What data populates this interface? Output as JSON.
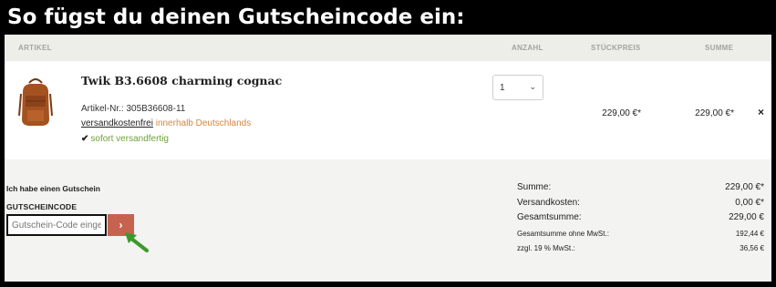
{
  "headline": "So fügst du deinen Gutscheincode ein:",
  "table": {
    "headers": {
      "artikel": "Artikel",
      "anzahl": "Anzahl",
      "stueckpreis": "Stückpreis",
      "summe": "Summe"
    }
  },
  "product": {
    "name": "Twik B3.6608 charming cognac",
    "article_number": "Artikel-Nr.: 305B36608-11",
    "shipping_link": "versandkostenfrei",
    "shipping_region": " innerhalb Deutschlands",
    "stock_icon": "check-icon",
    "stock_text": "sofort versandfertig",
    "quantity": "1",
    "unit_price": "229,00 €*",
    "row_total": "229,00 €*",
    "remove_symbol": "×"
  },
  "voucher": {
    "toggle_label": "Ich habe einen Gutschein",
    "heading": "Gutscheincode",
    "placeholder": "Gutschein-Code eingeben",
    "submit_symbol": "›"
  },
  "totals": [
    {
      "label": "Summe:",
      "value": "229,00 €*"
    },
    {
      "label": "Versandkosten:",
      "value": "0,00 €*"
    },
    {
      "label": "Gesamtsumme:",
      "value": "229,00 €"
    },
    {
      "label": "Gesamtsumme ohne MwSt.:",
      "value": "192,44 €"
    },
    {
      "label": "zzgl. 19 % MwSt.:",
      "value": "36,56 €"
    }
  ],
  "colors": {
    "accent_button": "#c7624f",
    "in_stock_green": "#6fa23a",
    "region_orange": "#d38741",
    "annotation_arrow": "#3a9a2a"
  }
}
